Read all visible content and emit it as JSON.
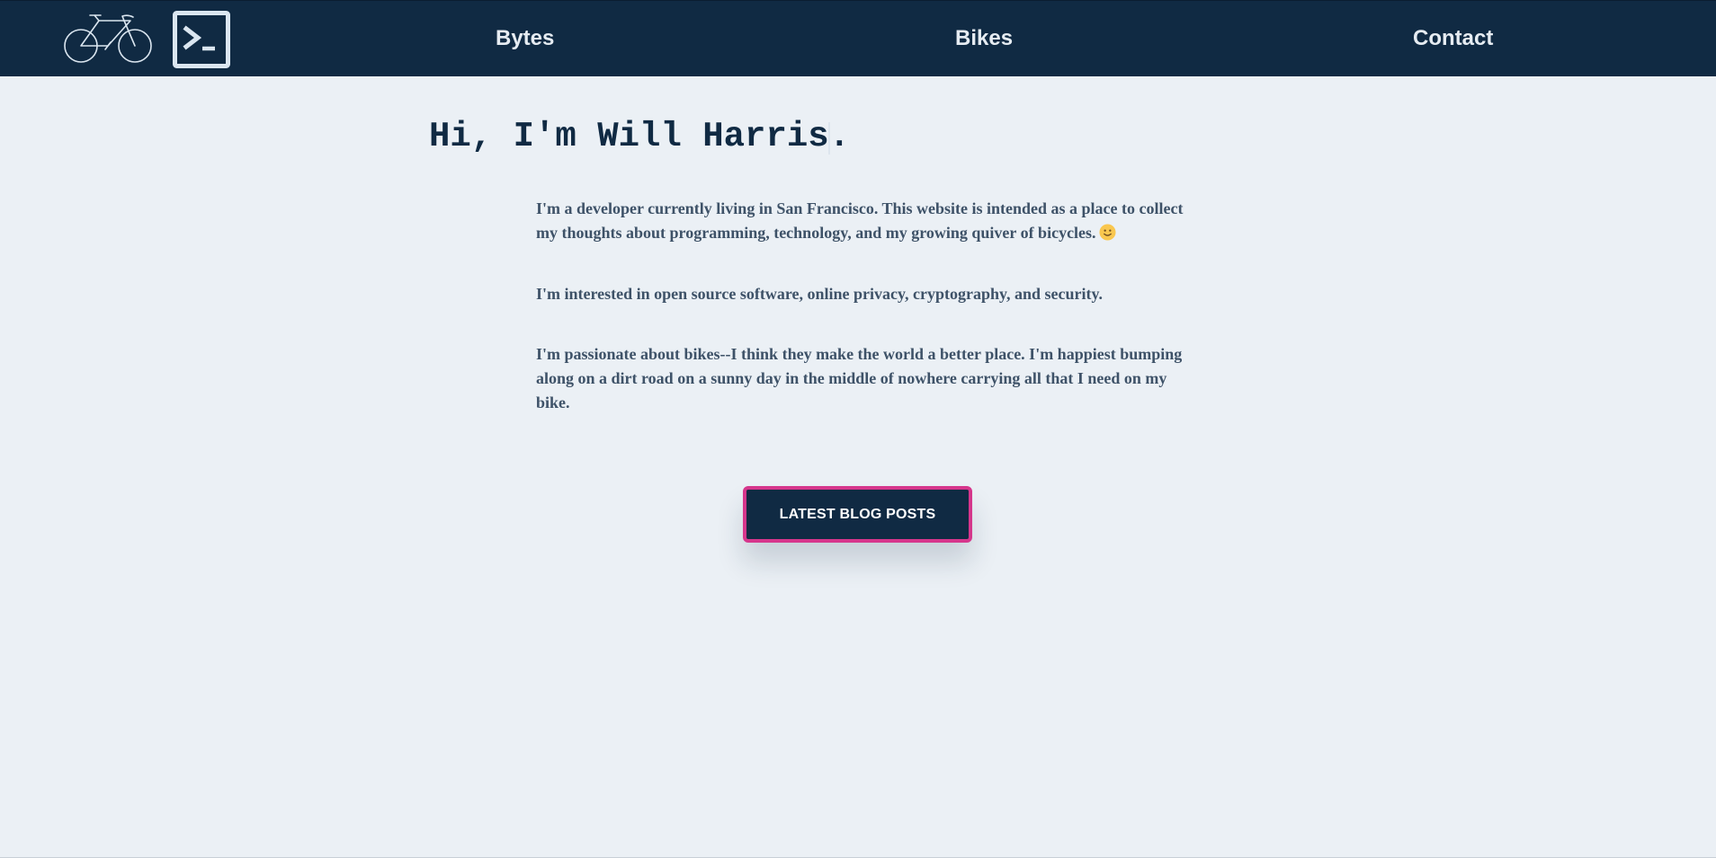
{
  "nav": {
    "links": [
      {
        "label": "Bytes"
      },
      {
        "label": "Bikes"
      },
      {
        "label": "Contact"
      }
    ],
    "bike_logo_icon": "bicycle-icon",
    "terminal_logo_icon": "terminal-icon"
  },
  "hero": {
    "headline": "Hi, I'm Will Harris."
  },
  "bio": {
    "paragraph_1": "I'm a developer currently living in San Francisco. This website is intended as a place to collect my thoughts about programming, technology, and my growing quiver of bicycles.",
    "paragraph_1_emoji": "slightly-smiling-face-icon",
    "paragraph_2": "I'm interested in open source software, online privacy, cryptography, and security.",
    "paragraph_3": "I'm passionate about bikes--I think they make the world a better place. I'm happiest bumping along on a dirt road on a sunny day in the middle of nowhere carrying all that I need on my bike."
  },
  "cta": {
    "label": "LATEST BLOG POSTS"
  },
  "colors": {
    "navbar_bg": "#102a43",
    "page_bg": "#ebf0f5",
    "accent_border": "#d6368c",
    "nav_text": "#e6ecf2",
    "body_text": "#3e5268"
  }
}
